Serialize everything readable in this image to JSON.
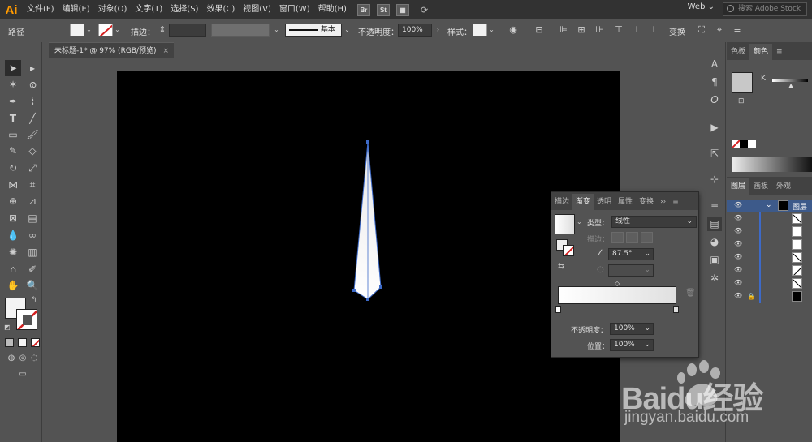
{
  "app": {
    "logo": "Ai"
  },
  "menu": [
    "文件(F)",
    "编辑(E)",
    "对象(O)",
    "文字(T)",
    "选择(S)",
    "效果(C)",
    "视图(V)",
    "窗口(W)",
    "帮助(H)"
  ],
  "bridge_labels": [
    "Br",
    "St"
  ],
  "workspace": "Web",
  "search_placeholder": "搜索 Adobe Stock",
  "control": {
    "object_type": "路径",
    "stroke_label": "描边：",
    "profile_label": "基本",
    "opacity_label": "不透明度：",
    "opacity_value": "100%",
    "style_label": "样式：",
    "transform_label": "变换"
  },
  "document_tab": {
    "title": "未标题-1* @ 97% (RGB/预览)",
    "close": "×"
  },
  "right_panel": {
    "top_tabs": [
      "色板",
      "颜色"
    ],
    "color_channel": "K",
    "layer_tabs": [
      "图层",
      "画板",
      "外观"
    ],
    "layer_name": "图层"
  },
  "gradient_panel": {
    "tabs": [
      "描边",
      "渐变",
      "透明",
      "属性",
      "变换"
    ],
    "type_label": "类型：",
    "type_value": "线性",
    "stroke_label": "描边：",
    "angle_value": "87.5°",
    "opacity_label": "不透明度：",
    "opacity_value": "100%",
    "location_label": "位置：",
    "location_value": "100%"
  },
  "watermark": {
    "brand": "Baidu经验",
    "url": "jingyan.baidu.com"
  },
  "colors": {
    "accent_orange": "#ff9a00",
    "selection_blue": "#3d6ac8",
    "artboard": "#000000"
  }
}
